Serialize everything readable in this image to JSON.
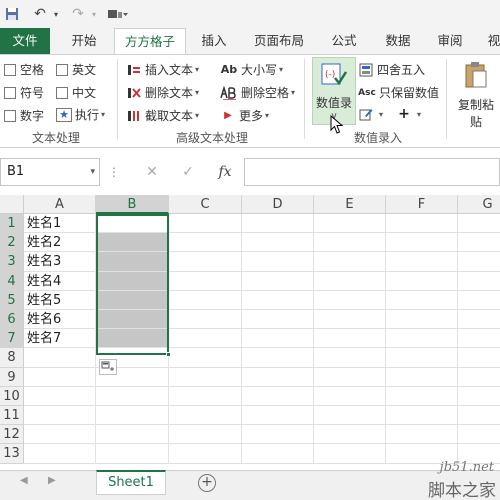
{
  "qat": {
    "save_icon": "save-icon",
    "undo_icon": "undo-icon",
    "redo_icon": "redo-icon",
    "customize_icon": "customize-icon"
  },
  "tabs": [
    {
      "label": "文件"
    },
    {
      "label": "开始"
    },
    {
      "label": "方方格子"
    },
    {
      "label": "插入"
    },
    {
      "label": "页面布局"
    },
    {
      "label": "公式"
    },
    {
      "label": "数据"
    },
    {
      "label": "审阅"
    },
    {
      "label": "视"
    }
  ],
  "ribbon": {
    "text_proc": {
      "label": "文本处理",
      "checks": [
        "空格",
        "英文",
        "符号",
        "中文",
        "数字"
      ],
      "exec": "执行"
    },
    "adv_text": {
      "label": "高级文本处理",
      "insert": "插入文本",
      "delete": "删除文本",
      "extract": "截取文本",
      "case": "大小写",
      "case_icon_text": "Ab",
      "del_space": "删除空格",
      "more": "更多"
    },
    "num_entry": {
      "label": "数值录入",
      "big": "数值录",
      "round": "四舍五入",
      "keep": "只保留数值",
      "keep_icon_text": "Asc"
    },
    "paste": {
      "label1": "复制粘",
      "label2": "贴"
    }
  },
  "formula_bar": {
    "name_box": "B1",
    "cancel": "✕",
    "enter": "✓",
    "fx": "fx"
  },
  "columns": [
    "A",
    "B",
    "C",
    "D",
    "E",
    "F",
    "G"
  ],
  "rows": [
    "1",
    "2",
    "3",
    "4",
    "5",
    "6",
    "7",
    "8",
    "9",
    "10",
    "11",
    "12",
    "13"
  ],
  "cells_a": [
    "姓名1",
    "姓名2",
    "姓名3",
    "姓名4",
    "姓名5",
    "姓名6",
    "姓名7"
  ],
  "sheet": {
    "name": "Sheet1",
    "add": "+"
  },
  "watermark": {
    "site": "jb51.net",
    "name": "脚本之家"
  },
  "colors": {
    "accent": "#217346",
    "selection": "#c6c6c6"
  }
}
